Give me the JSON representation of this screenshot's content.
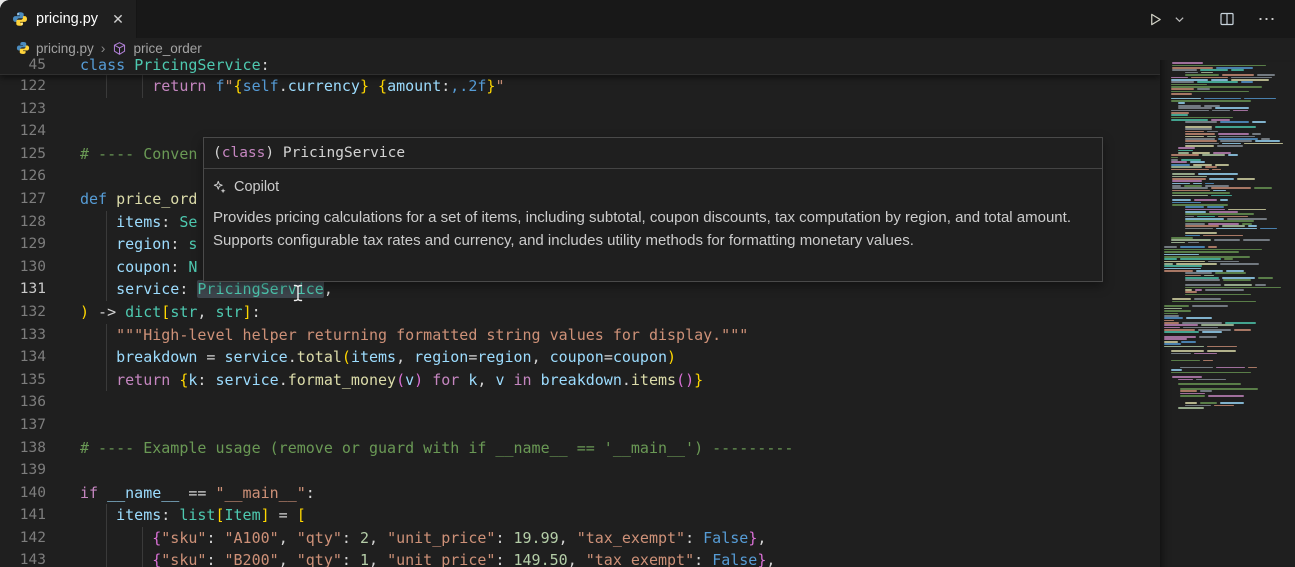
{
  "colors": {
    "editor_bg": "#1f1f1f",
    "tabbar_bg": "#181818",
    "tooltip_border": "#4a4a4a",
    "keyword_blue": "#569cd6",
    "keyword_purple": "#c586c0",
    "function_yellow": "#dcdcaa",
    "type_teal": "#4ec9b0",
    "variable_blue": "#9cdcfe",
    "string_orange": "#ce9178",
    "number_green": "#b5cea8",
    "comment_green": "#6a9955",
    "bracket_gold": "#ffd700",
    "bracket_pink": "#da70d6",
    "python_icon_blue": "#4b8bbe",
    "python_icon_yellow": "#ffd43b",
    "symbol_icon_purple": "#b180d7"
  },
  "tab_bar": {
    "tabs": [
      {
        "label": "pricing.py",
        "icon": "python-icon",
        "close_glyph": "✕"
      }
    ],
    "actions": {
      "icons": [
        {
          "name": "run-icon",
          "glyph": "▷"
        },
        {
          "name": "chevron-down-icon",
          "glyph": "⌄"
        },
        {
          "name": "split-editor-icon",
          "glyph": "◫"
        },
        {
          "name": "more-actions-icon",
          "glyph": "⋯"
        }
      ],
      "more_glyph": "⋯"
    }
  },
  "breadcrumb": {
    "separator": "›",
    "items": [
      {
        "label": "pricing.py",
        "icon": "python-icon"
      },
      {
        "label": "price_order",
        "icon": "symbol-icon"
      }
    ]
  },
  "editor": {
    "sticky": {
      "num": "45",
      "tokens": [
        [
          "kw",
          "class"
        ],
        [
          "pun",
          " "
        ],
        [
          "type",
          "PricingService"
        ],
        [
          "pun",
          ":"
        ]
      ]
    },
    "active_line": "131",
    "word_highlight": "PricingService",
    "lines": [
      {
        "num": "122",
        "guides": [
          4,
          8
        ],
        "tokens": [
          [
            "pun",
            "        "
          ],
          [
            "ctrl",
            "return"
          ],
          [
            "pun",
            " "
          ],
          [
            "kw",
            "f"
          ],
          [
            "str",
            "\""
          ],
          [
            "b1",
            "{"
          ],
          [
            "kw",
            "self"
          ],
          [
            "pun",
            "."
          ],
          [
            "var",
            "currency"
          ],
          [
            "b1",
            "}"
          ],
          [
            "str",
            " "
          ],
          [
            "b1",
            "{"
          ],
          [
            "var",
            "amount"
          ],
          [
            "pun",
            ":"
          ],
          [
            "kw",
            ",.2f"
          ],
          [
            "b1",
            "}"
          ],
          [
            "str",
            "\""
          ]
        ]
      },
      {
        "num": "123",
        "tokens": []
      },
      {
        "num": "124",
        "tokens": []
      },
      {
        "num": "125",
        "tokens": [
          [
            "com",
            "# ---- Conven"
          ]
        ]
      },
      {
        "num": "126",
        "tokens": []
      },
      {
        "num": "127",
        "tokens": [
          [
            "kw",
            "def"
          ],
          [
            "pun",
            " "
          ],
          [
            "fn",
            "price_ord"
          ]
        ]
      },
      {
        "num": "128",
        "guides": [
          4
        ],
        "tokens": [
          [
            "pun",
            "    "
          ],
          [
            "var",
            "items"
          ],
          [
            "pun",
            ": "
          ],
          [
            "type",
            "Se"
          ]
        ]
      },
      {
        "num": "129",
        "guides": [
          4
        ],
        "tokens": [
          [
            "pun",
            "    "
          ],
          [
            "var",
            "region"
          ],
          [
            "pun",
            ": "
          ],
          [
            "type",
            "s"
          ]
        ]
      },
      {
        "num": "130",
        "guides": [
          4
        ],
        "tokens": [
          [
            "pun",
            "    "
          ],
          [
            "var",
            "coupon"
          ],
          [
            "pun",
            ": "
          ],
          [
            "type",
            "N"
          ]
        ]
      },
      {
        "num": "131",
        "active": true,
        "guides": [
          4
        ],
        "tokens": [
          [
            "pun",
            "    "
          ],
          [
            "var",
            "service"
          ],
          [
            "pun",
            ": "
          ],
          [
            "hl",
            "PricingService"
          ],
          [
            "pun",
            ","
          ]
        ]
      },
      {
        "num": "132",
        "tokens": [
          [
            "b1",
            ")"
          ],
          [
            "pun",
            " -> "
          ],
          [
            "type",
            "dict"
          ],
          [
            "b1",
            "["
          ],
          [
            "type",
            "str"
          ],
          [
            "pun",
            ", "
          ],
          [
            "type",
            "str"
          ],
          [
            "b1",
            "]"
          ],
          [
            "pun",
            ":"
          ]
        ]
      },
      {
        "num": "133",
        "guides": [
          4
        ],
        "tokens": [
          [
            "pun",
            "    "
          ],
          [
            "str",
            "\"\"\"High-level helper returning formatted string values for display.\"\"\""
          ]
        ]
      },
      {
        "num": "134",
        "guides": [
          4
        ],
        "tokens": [
          [
            "pun",
            "    "
          ],
          [
            "var",
            "breakdown"
          ],
          [
            "pun",
            " = "
          ],
          [
            "var",
            "service"
          ],
          [
            "pun",
            "."
          ],
          [
            "fn",
            "total"
          ],
          [
            "b1",
            "("
          ],
          [
            "var",
            "items"
          ],
          [
            "pun",
            ", "
          ],
          [
            "var",
            "region"
          ],
          [
            "pun",
            "="
          ],
          [
            "var",
            "region"
          ],
          [
            "pun",
            ", "
          ],
          [
            "var",
            "coupon"
          ],
          [
            "pun",
            "="
          ],
          [
            "var",
            "coupon"
          ],
          [
            "b1",
            ")"
          ]
        ]
      },
      {
        "num": "135",
        "guides": [
          4
        ],
        "tokens": [
          [
            "pun",
            "    "
          ],
          [
            "ctrl",
            "return"
          ],
          [
            "pun",
            " "
          ],
          [
            "b1",
            "{"
          ],
          [
            "var",
            "k"
          ],
          [
            "pun",
            ": "
          ],
          [
            "var",
            "service"
          ],
          [
            "pun",
            "."
          ],
          [
            "fn",
            "format_money"
          ],
          [
            "b2",
            "("
          ],
          [
            "var",
            "v"
          ],
          [
            "b2",
            ")"
          ],
          [
            "pun",
            " "
          ],
          [
            "ctrl",
            "for"
          ],
          [
            "pun",
            " "
          ],
          [
            "var",
            "k"
          ],
          [
            "pun",
            ", "
          ],
          [
            "var",
            "v"
          ],
          [
            "pun",
            " "
          ],
          [
            "ctrl",
            "in"
          ],
          [
            "pun",
            " "
          ],
          [
            "var",
            "breakdown"
          ],
          [
            "pun",
            "."
          ],
          [
            "fn",
            "items"
          ],
          [
            "b2",
            "()"
          ],
          [
            "b1",
            "}"
          ]
        ]
      },
      {
        "num": "136",
        "tokens": []
      },
      {
        "num": "137",
        "tokens": []
      },
      {
        "num": "138",
        "tokens": [
          [
            "com",
            "# ---- Example usage (remove or guard with if __name__ == '__main__') ---------"
          ]
        ]
      },
      {
        "num": "139",
        "tokens": []
      },
      {
        "num": "140",
        "tokens": [
          [
            "ctrl",
            "if"
          ],
          [
            "pun",
            " "
          ],
          [
            "var",
            "__name__"
          ],
          [
            "pun",
            " == "
          ],
          [
            "str",
            "\"__main__\""
          ],
          [
            "pun",
            ":"
          ]
        ]
      },
      {
        "num": "141",
        "guides": [
          4
        ],
        "tokens": [
          [
            "pun",
            "    "
          ],
          [
            "var",
            "items"
          ],
          [
            "pun",
            ": "
          ],
          [
            "type",
            "list"
          ],
          [
            "b1",
            "["
          ],
          [
            "type",
            "Item"
          ],
          [
            "b1",
            "]"
          ],
          [
            "pun",
            " = "
          ],
          [
            "b1",
            "["
          ]
        ]
      },
      {
        "num": "142",
        "guides": [
          4,
          8
        ],
        "tokens": [
          [
            "pun",
            "        "
          ],
          [
            "b2",
            "{"
          ],
          [
            "str",
            "\"sku\""
          ],
          [
            "pun",
            ": "
          ],
          [
            "str",
            "\"A100\""
          ],
          [
            "pun",
            ", "
          ],
          [
            "str",
            "\"qty\""
          ],
          [
            "pun",
            ": "
          ],
          [
            "num",
            "2"
          ],
          [
            "pun",
            ", "
          ],
          [
            "str",
            "\"unit_price\""
          ],
          [
            "pun",
            ": "
          ],
          [
            "num",
            "19.99"
          ],
          [
            "pun",
            ", "
          ],
          [
            "str",
            "\"tax_exempt\""
          ],
          [
            "pun",
            ": "
          ],
          [
            "kw",
            "False"
          ],
          [
            "b2",
            "}"
          ],
          [
            "pun",
            ","
          ]
        ]
      },
      {
        "num": "143",
        "guides": [
          4,
          8
        ],
        "tokens": [
          [
            "pun",
            "        "
          ],
          [
            "b2",
            "{"
          ],
          [
            "str",
            "\"sku\""
          ],
          [
            "pun",
            ": "
          ],
          [
            "str",
            "\"B200\""
          ],
          [
            "pun",
            ", "
          ],
          [
            "str",
            "\"qty\""
          ],
          [
            "pun",
            ": "
          ],
          [
            "num",
            "1"
          ],
          [
            "pun",
            ", "
          ],
          [
            "str",
            "\"unit_price\""
          ],
          [
            "pun",
            ": "
          ],
          [
            "num",
            "149.50"
          ],
          [
            "pun",
            ", "
          ],
          [
            "str",
            "\"tax_exempt\""
          ],
          [
            "pun",
            ": "
          ],
          [
            "kw",
            "False"
          ],
          [
            "b2",
            "}"
          ],
          [
            "pun",
            ","
          ]
        ]
      }
    ]
  },
  "tooltip": {
    "signature_tokens": [
      [
        "pun",
        "("
      ],
      [
        "ctrl",
        "class"
      ],
      [
        "pun",
        ") "
      ],
      [
        "pun",
        "PricingService"
      ]
    ],
    "provider": "Copilot",
    "body": "Provides pricing calculations for a set of items, including subtotal, coupon discounts, tax computation by region, and total amount. Supports configurable tax rates and currency, and includes utility methods for formatting monetary values."
  }
}
